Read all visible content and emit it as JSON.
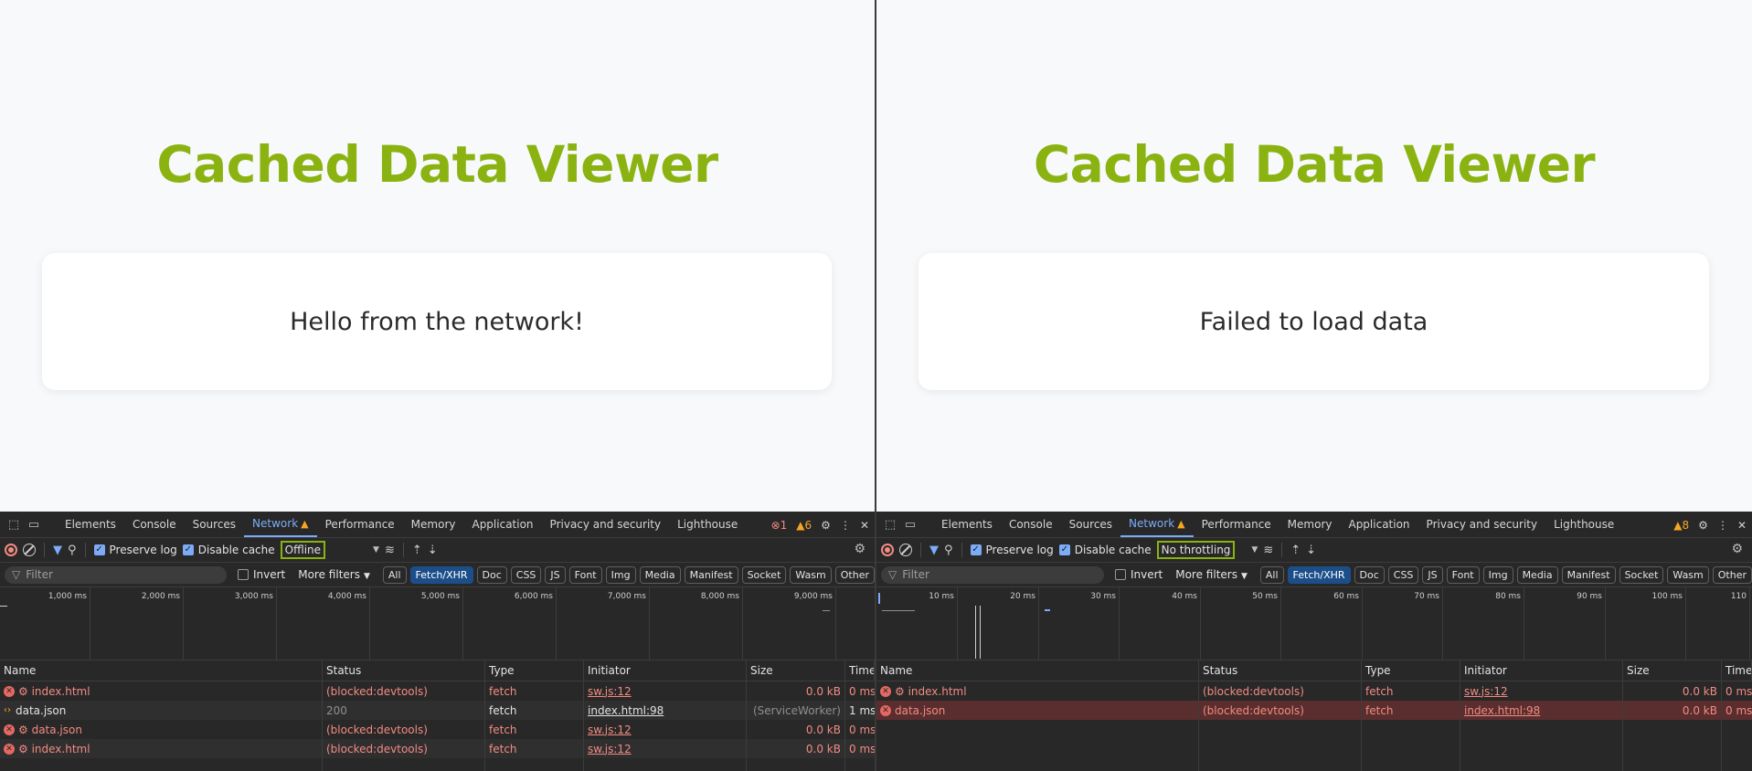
{
  "panes": [
    {
      "page": {
        "title": "Cached Data Viewer",
        "message": "Hello from the network!"
      },
      "devtools": {
        "tabs": [
          "Elements",
          "Console",
          "Sources",
          "Network",
          "Performance",
          "Memory",
          "Application",
          "Privacy and security",
          "Lighthouse"
        ],
        "active_tab": "Network",
        "error_count": "1",
        "warning_count": "6",
        "toolbar": {
          "preserve_log": "Preserve log",
          "disable_cache": "Disable cache",
          "throttling": "Offline"
        },
        "filter": {
          "placeholder": "Filter",
          "invert": "Invert",
          "more_filters": "More filters"
        },
        "type_filters": [
          "All",
          "Fetch/XHR",
          "Doc",
          "CSS",
          "JS",
          "Font",
          "Img",
          "Media",
          "Manifest",
          "Socket",
          "Wasm",
          "Other"
        ],
        "selected_type_filter": "Fetch/XHR",
        "timeline_ticks": [
          "1,000 ms",
          "2,000 ms",
          "3,000 ms",
          "4,000 ms",
          "5,000 ms",
          "6,000 ms",
          "7,000 ms",
          "8,000 ms",
          "9,000 ms"
        ],
        "columns": [
          "Name",
          "Status",
          "Type",
          "Initiator",
          "Size",
          "Time"
        ],
        "rows": [
          {
            "icon": "error",
            "name": "⚙ index.html",
            "status": "(blocked:devtools)",
            "type": "fetch",
            "initiator": "sw.js:12",
            "size": "0.0 kB",
            "time": "0 ms"
          },
          {
            "icon": "json",
            "name": "data.json",
            "status": "200",
            "type": "fetch",
            "initiator": "index.html:98",
            "size": "(ServiceWorker)",
            "time": "1 ms"
          },
          {
            "icon": "error",
            "name": "⚙ data.json",
            "status": "(blocked:devtools)",
            "type": "fetch",
            "initiator": "sw.js:12",
            "size": "0.0 kB",
            "time": "0 ms"
          },
          {
            "icon": "error",
            "name": "⚙ index.html",
            "status": "(blocked:devtools)",
            "type": "fetch",
            "initiator": "sw.js:12",
            "size": "0.0 kB",
            "time": "0 ms"
          }
        ]
      }
    },
    {
      "page": {
        "title": "Cached Data Viewer",
        "message": "Failed to load data"
      },
      "devtools": {
        "tabs": [
          "Elements",
          "Console",
          "Sources",
          "Network",
          "Performance",
          "Memory",
          "Application",
          "Privacy and security",
          "Lighthouse"
        ],
        "active_tab": "Network",
        "warning_count": "8",
        "toolbar": {
          "preserve_log": "Preserve log",
          "disable_cache": "Disable cache",
          "throttling": "No throttling"
        },
        "filter": {
          "placeholder": "Filter",
          "invert": "Invert",
          "more_filters": "More filters"
        },
        "type_filters": [
          "All",
          "Fetch/XHR",
          "Doc",
          "CSS",
          "JS",
          "Font",
          "Img",
          "Media",
          "Manifest",
          "Socket",
          "Wasm",
          "Other"
        ],
        "selected_type_filter": "Fetch/XHR",
        "timeline_ticks": [
          "10 ms",
          "20 ms",
          "30 ms",
          "40 ms",
          "50 ms",
          "60 ms",
          "70 ms",
          "80 ms",
          "90 ms",
          "100 ms",
          "110"
        ],
        "columns": [
          "Name",
          "Status",
          "Type",
          "Initiator",
          "Size",
          "Time"
        ],
        "rows": [
          {
            "icon": "error",
            "name": "⚙ index.html",
            "status": "(blocked:devtools)",
            "type": "fetch",
            "initiator": "sw.js:12",
            "size": "0.0 kB",
            "time": "0 ms"
          },
          {
            "icon": "error",
            "name": "data.json",
            "status": "(blocked:devtools)",
            "type": "fetch",
            "initiator": "index.html:98",
            "size": "0.0 kB",
            "time": "0 ms",
            "selected": true
          }
        ]
      }
    }
  ],
  "colors": {
    "title_green": "#8ab312",
    "link_blue": "#7cacf8",
    "error_red": "#f28b82",
    "warning_orange": "#f5a623"
  }
}
